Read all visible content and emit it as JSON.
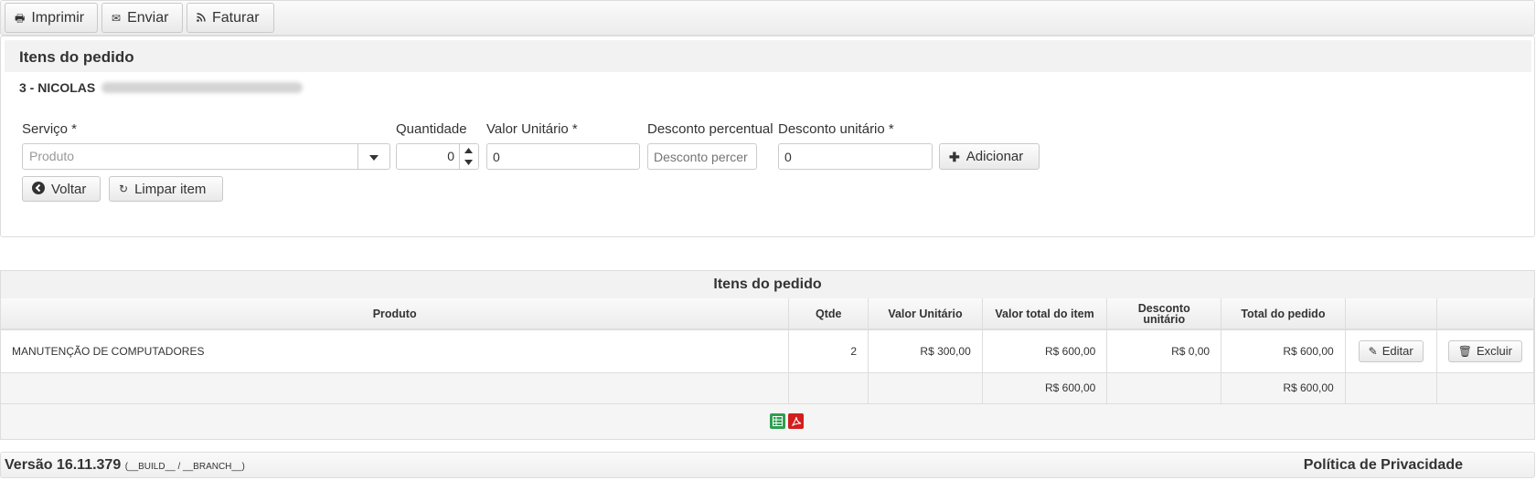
{
  "toolbar": {
    "print_label": "Imprimir",
    "send_label": "Enviar",
    "invoice_label": "Faturar"
  },
  "form": {
    "title": "Itens do pedido",
    "client": "3 - NICOLAS",
    "labels": {
      "service": "Serviço *",
      "quantity": "Quantidade",
      "unit_value": "Valor Unitário *",
      "percent_discount": "Desconto percentual",
      "unit_discount": "Desconto unitário *"
    },
    "service_placeholder": "Produto",
    "quantity_value": "0",
    "unit_value": "0",
    "percent_discount_placeholder": "Desconto percer",
    "unit_discount_value": "0",
    "add_label": "Adicionar",
    "back_label": "Voltar",
    "clear_label": "Limpar item"
  },
  "table": {
    "title": "Itens do pedido",
    "headers": {
      "product": "Produto",
      "qty": "Qtde",
      "unit_value": "Valor Unitário",
      "item_total": "Valor total do item",
      "unit_discount_1": "Desconto",
      "unit_discount_2": "unitário",
      "order_total": "Total do pedido"
    },
    "rows": [
      {
        "product": "MANUTENÇÃO DE COMPUTADORES",
        "qty": "2",
        "unit_value": "R$ 300,00",
        "item_total": "R$ 600,00",
        "unit_discount": "R$ 0,00",
        "order_total": "R$ 600,00"
      }
    ],
    "edit_label": "Editar",
    "delete_label": "Excluir",
    "totals": {
      "item_total": "R$ 600,00",
      "order_total": "R$ 600,00"
    }
  },
  "footer": {
    "version": "Versão 16.11.379",
    "build": "(__BUILD__ / __BRANCH__)",
    "privacy": "Política de Privacidade"
  },
  "icons": {
    "print": "printer-icon",
    "send": "envelope-icon",
    "invoice": "rss-icon",
    "add": "plus-icon",
    "back": "arrow-left-circle-icon",
    "clear": "undo-icon",
    "edit": "pencil-icon",
    "delete": "trash-icon",
    "export_excel": "spreadsheet-icon",
    "export_pdf": "pdf-icon"
  },
  "colors": {
    "excel": "#2e9e4f",
    "pdf": "#d11e1e"
  }
}
